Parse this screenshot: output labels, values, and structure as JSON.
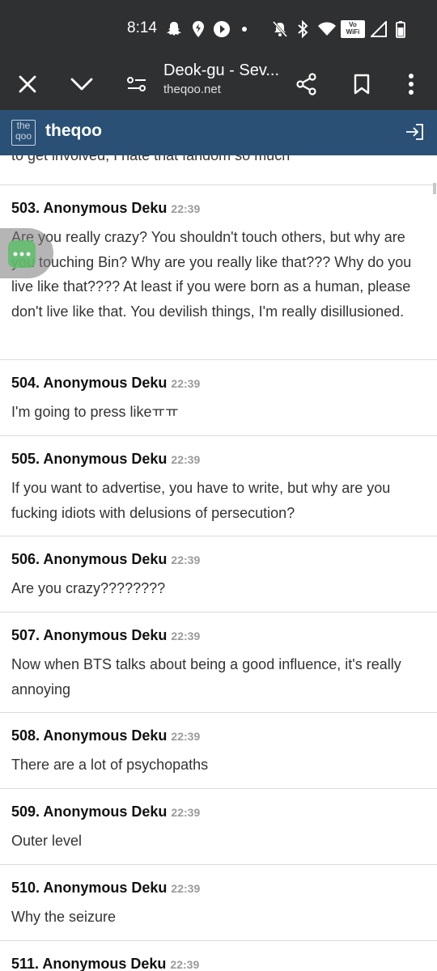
{
  "status_bar": {
    "time": "8:14",
    "icons": [
      "snapchat-icon",
      "location-icon",
      "play-icon",
      "dot-icon",
      "mute-icon",
      "bluetooth-icon",
      "wifi-icon",
      "vowifi-icon",
      "signal-icon",
      "battery-icon"
    ],
    "vowifi_label": "Vo WiFi"
  },
  "browser": {
    "title": "Deok-gu - Sev...",
    "url": "theqoo.net"
  },
  "site": {
    "logo_text": "the qoo",
    "name": "theqoo",
    "colors": {
      "header": "#2b5076",
      "toolbar": "#2f3032"
    }
  },
  "previous_comment_tail": "to get involved, I hate that fandom so much",
  "comments": [
    {
      "number": "503.",
      "author": "Anonymous Deku",
      "time": "22:39",
      "text": "Are you really crazy? You shouldn't touch others, but why are you touching Bin? Why are you really like that??? Why do you live like that???? At least if you were born as a human, please don't live like that. You devilish things, I'm really disillusioned."
    },
    {
      "number": "504.",
      "author": "Anonymous Deku",
      "time": "22:39",
      "text": "I'm going to press likeㅠㅠ"
    },
    {
      "number": "505.",
      "author": "Anonymous Deku",
      "time": "22:39",
      "text": "If you want to advertise, you have to write, but why are you fucking idiots with delusions of persecution?"
    },
    {
      "number": "506.",
      "author": "Anonymous Deku",
      "time": "22:39",
      "text": "Are you crazy????????"
    },
    {
      "number": "507.",
      "author": "Anonymous Deku",
      "time": "22:39",
      "text": "Now when BTS talks about being a good influence, it's really annoying"
    },
    {
      "number": "508.",
      "author": "Anonymous Deku",
      "time": "22:39",
      "text": "There are a lot of psychopaths"
    },
    {
      "number": "509.",
      "author": "Anonymous Deku",
      "time": "22:39",
      "text": "Outer level"
    },
    {
      "number": "510.",
      "author": "Anonymous Deku",
      "time": "22:39",
      "text": "Why the seizure"
    },
    {
      "number": "511.",
      "author": "Anonymous Deku",
      "time": "22:39",
      "text": ""
    }
  ]
}
